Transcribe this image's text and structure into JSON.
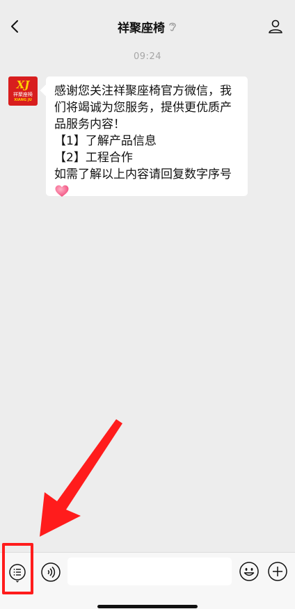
{
  "header": {
    "title": "祥聚座椅",
    "back_icon": "chevron-left-icon",
    "ear_icon": "ear-icon",
    "profile_icon": "person-icon"
  },
  "chat": {
    "timestamp": "09:24",
    "avatar": {
      "logo_mark": "XJ",
      "brand_cn": "祥聚座椅",
      "brand_en": "XIANG JU"
    },
    "message_lines": [
      "感谢您关注祥聚座椅官方微信，我",
      "们将竭诚为您服务，提供更优质产",
      "品服务内容！",
      "【1】了解产品信息",
      "【2】工程合作",
      "如需了解以上内容请回复数字序号"
    ],
    "emoji": "heart-icon"
  },
  "input_bar": {
    "menu_icon": "menu-list-icon",
    "voice_icon": "voice-icon",
    "text_value": "",
    "emoji_icon": "smile-icon",
    "plus_icon": "plus-icon"
  },
  "colors": {
    "background": "#ededed",
    "bubble": "#ffffff",
    "annotation": "#ff1c1c",
    "avatar_red": "#d81e1e",
    "avatar_gold": "#ffd200"
  }
}
